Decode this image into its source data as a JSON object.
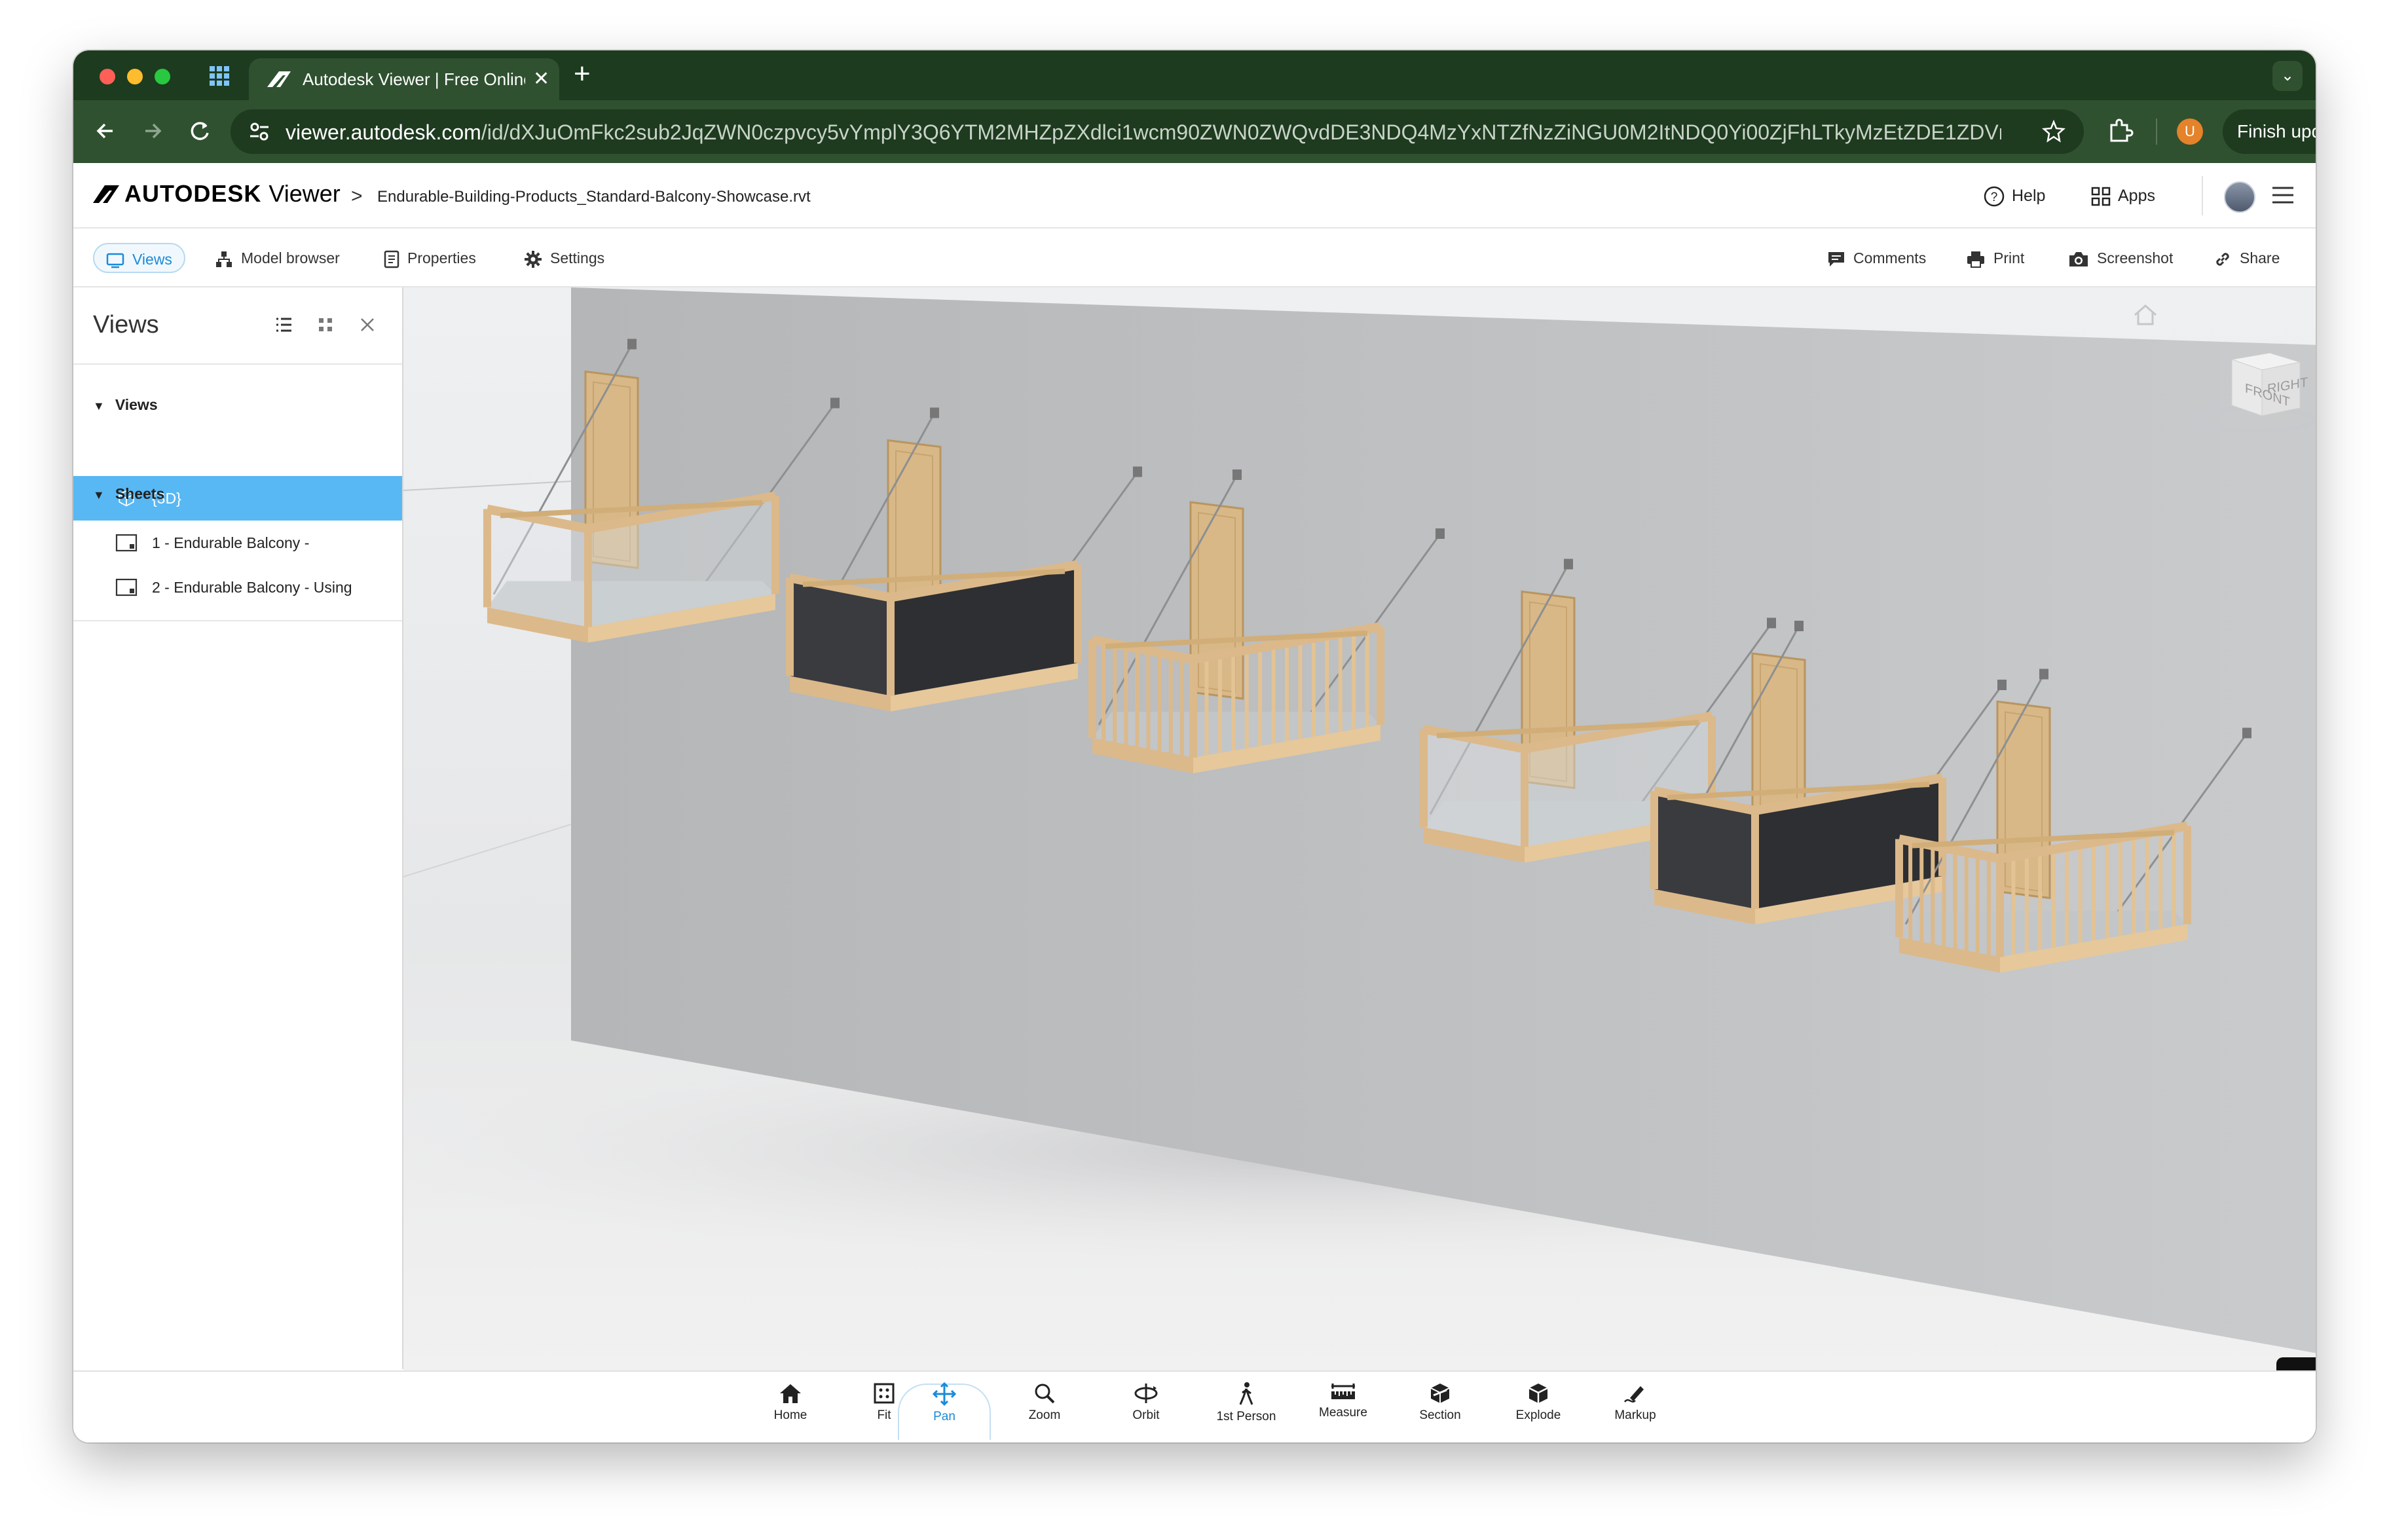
{
  "browser": {
    "tab_title": "Autodesk Viewer | Free Online",
    "tab_close": "✕",
    "new_tab": "+",
    "url_main": "viewer.autodesk.com",
    "url_rest": "/id/dXJuOmFkc2sub2JqZWN0czpvcy5vYmplY3Q6YTM2MHZpZXdlci1wcm90ZWN0ZWQvdDE3NDQ4MzYxNTZfNzZiNGU0M2ItNDQ0Yi00ZjFhLTkyMzEtZDE1ZDVmZjQ5Zm...",
    "profile_initial": "U",
    "finish_update": "Finish update",
    "menu_dots": "⋮"
  },
  "app": {
    "logo_brand": "AUTODESK",
    "logo_product": "Viewer",
    "breadcrumb_chevron": ">",
    "filename": "Endurable-Building-Products_Standard-Balcony-Showcase.rvt",
    "help": "Help",
    "apps": "Apps"
  },
  "toolbar": {
    "views": "Views",
    "model_browser": "Model browser",
    "properties": "Properties",
    "settings": "Settings",
    "comments": "Comments",
    "print": "Print",
    "screenshot": "Screenshot",
    "share": "Share"
  },
  "sidebar": {
    "title": "Views",
    "groups": [
      {
        "label": "Views",
        "items": [
          {
            "label": "{3D}",
            "selected": true
          }
        ]
      },
      {
        "label": "Sheets",
        "items": [
          {
            "label": "1 - Endurable Balcony -"
          },
          {
            "label": "2 - Endurable Balcony - Using"
          }
        ]
      }
    ]
  },
  "viewcube": {
    "front": "FRONT",
    "right": "RIGHT"
  },
  "bottom_tools": {
    "home": "Home",
    "fit": "Fit",
    "pan": "Pan",
    "zoom": "Zoom",
    "orbit": "Orbit",
    "first_person": "1st Person",
    "measure": "Measure",
    "section": "Section",
    "explode": "Explode",
    "markup": "Markup",
    "active": "pan"
  },
  "colors": {
    "chrome_dark": "#1d3b1e",
    "chrome_mid": "#2f5130",
    "accent": "#1a8bd8",
    "selected_row": "#58b8f4",
    "wood": "#dcb98a",
    "glass_panel": "#3a3b3e"
  }
}
